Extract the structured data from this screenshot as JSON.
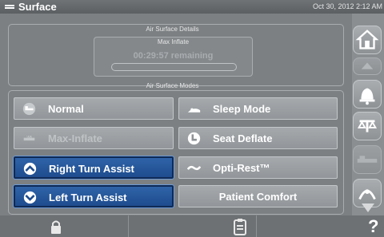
{
  "titlebar": {
    "title": "Surface",
    "datetime": "Oct 30, 2012 2:12 AM"
  },
  "details": {
    "caption": "Air Surface Details",
    "mode_title": "Max Inflate",
    "remaining": "00:29:57 remaining",
    "progress_fraction": 0.0
  },
  "modes": {
    "caption": "Air Surface Modes",
    "buttons": [
      {
        "label": "Normal",
        "icon": "normal-bed-icon",
        "state": "normal"
      },
      {
        "label": "Sleep Mode",
        "icon": "sleep-mode-icon",
        "state": "normal"
      },
      {
        "label": "Max-Inflate",
        "icon": "max-inflate-icon",
        "state": "disabled"
      },
      {
        "label": "Seat Deflate",
        "icon": "seat-deflate-icon",
        "state": "normal"
      },
      {
        "label": "Right Turn Assist",
        "icon": "right-turn-icon",
        "state": "selected"
      },
      {
        "label": "Opti-Rest™",
        "icon": "opti-rest-icon",
        "state": "normal"
      },
      {
        "label": "Left Turn Assist",
        "icon": "left-turn-icon",
        "state": "selected"
      },
      {
        "label": "Patient Comfort",
        "icon": "",
        "state": "normal"
      }
    ]
  },
  "bottombar": {
    "help_label": "?"
  },
  "colors": {
    "selected": "#2a5c9e",
    "button": "#9b9fa2",
    "background": "#7c8083"
  }
}
